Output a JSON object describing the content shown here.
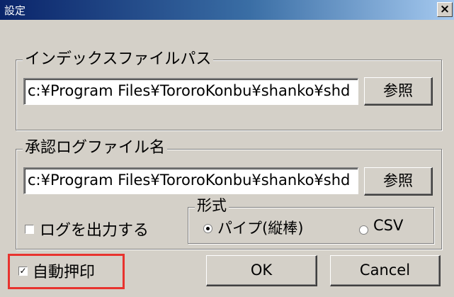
{
  "window": {
    "title": "設定",
    "close_glyph": "×"
  },
  "index_group": {
    "legend": "インデックスファイルパス",
    "path_value": "c:¥Program Files¥TororoKonbu¥shanko¥shd",
    "browse_label": "参照"
  },
  "log_group": {
    "legend": "承認ログファイル名",
    "path_value": "c:¥Program Files¥TororoKonbu¥shanko¥shd",
    "browse_label": "参照",
    "output_log_label": "ログを出力する",
    "output_log_checked": false,
    "format": {
      "legend": "形式",
      "options": [
        {
          "label": "パイプ(縦棒)",
          "selected": true
        },
        {
          "label": "CSV",
          "selected": false
        }
      ]
    }
  },
  "auto_stamp": {
    "label": "自動押印",
    "checked": true,
    "highlight_color": "#e8332e"
  },
  "buttons": {
    "ok_label": "OK",
    "cancel_label": "Cancel"
  },
  "colors": {
    "face": "#d4d0c8",
    "title_start": "#0a246a",
    "title_end": "#a6caf0"
  }
}
